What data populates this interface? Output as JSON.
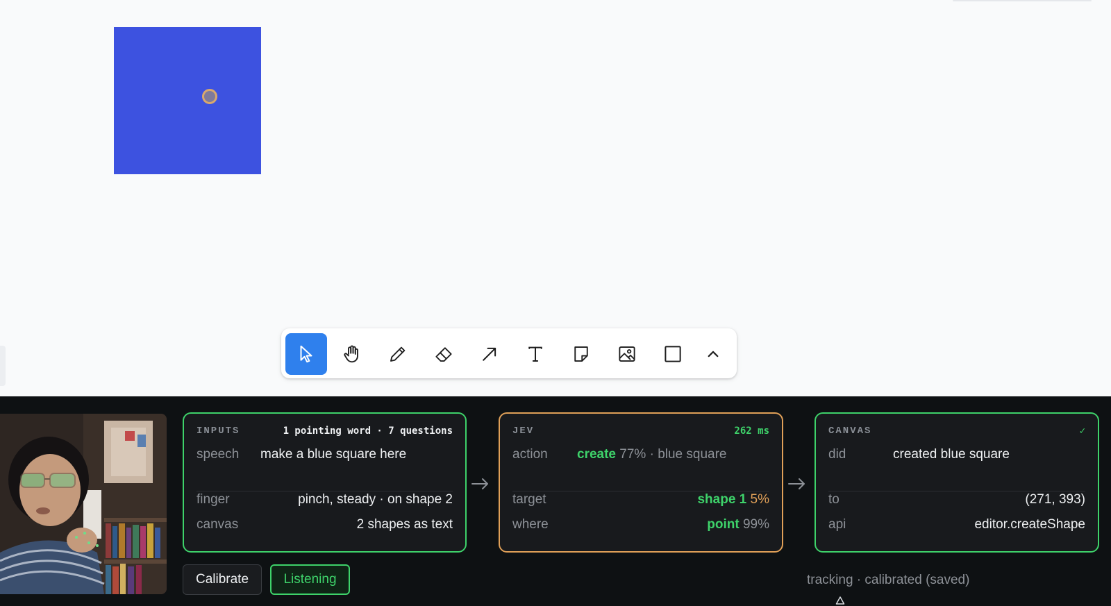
{
  "canvas": {
    "shape_color": "#3d52e0",
    "background": "#f9fafb"
  },
  "toolbar": {
    "active_tool": "select",
    "tools": [
      {
        "name": "select",
        "icon": "select-cursor-icon"
      },
      {
        "name": "hand",
        "icon": "hand-icon"
      },
      {
        "name": "draw",
        "icon": "pencil-icon"
      },
      {
        "name": "eraser",
        "icon": "eraser-icon"
      },
      {
        "name": "arrow",
        "icon": "arrow-icon"
      },
      {
        "name": "text",
        "icon": "text-icon"
      },
      {
        "name": "note",
        "icon": "note-icon"
      },
      {
        "name": "media",
        "icon": "image-icon"
      },
      {
        "name": "rectangle",
        "icon": "rectangle-icon"
      },
      {
        "name": "more",
        "icon": "chevron-up-icon"
      }
    ],
    "accent": "#2f80ed"
  },
  "inputs": {
    "title": "INPUTS",
    "meta": "1 pointing word · 7 questions",
    "speech_label": "speech",
    "speech_value": "make a blue square here",
    "finger_label": "finger",
    "finger_value": "pinch, steady · on shape 2",
    "canvas_label": "canvas",
    "canvas_value": "2 shapes as text",
    "border_color": "#3ed26a"
  },
  "jev": {
    "title": "JEV",
    "meta": "262 ms",
    "action_label": "action",
    "action_verb": "create",
    "action_pct": "77%",
    "action_rest": "· blue square",
    "target_label": "target",
    "target_value": "shape 1",
    "target_pct": "5%",
    "where_label": "where",
    "where_value": "point",
    "where_pct": "99%",
    "border_color": "#e0a058"
  },
  "canvas_card": {
    "title": "CANVAS",
    "meta": "✓",
    "did_label": "did",
    "did_value": "created blue square",
    "to_label": "to",
    "to_value": "(271, 393)",
    "api_label": "api",
    "api_value": "editor.createShape",
    "border_color": "#3ed26a"
  },
  "controls": {
    "calibrate_label": "Calibrate",
    "listening_label": "Listening",
    "status_text": "tracking · calibrated (saved)"
  }
}
